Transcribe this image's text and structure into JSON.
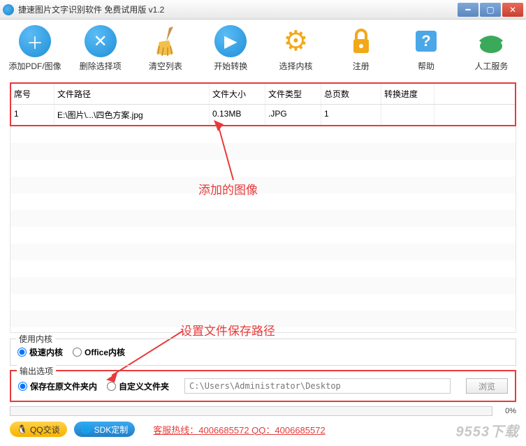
{
  "title": "捷速图片文字识别软件 免费试用版 v1.2",
  "toolbar": [
    {
      "id": "add",
      "label": "添加PDF/图像",
      "glyph": "+"
    },
    {
      "id": "del",
      "label": "删除选择项",
      "glyph": "✕"
    },
    {
      "id": "clear",
      "label": "清空列表",
      "glyph": "broom"
    },
    {
      "id": "start",
      "label": "开始转换",
      "glyph": "▶"
    },
    {
      "id": "engine",
      "label": "选择内核",
      "glyph": "⚙"
    },
    {
      "id": "reg",
      "label": "注册",
      "glyph": "lock"
    },
    {
      "id": "help",
      "label": "帮助",
      "glyph": "?"
    },
    {
      "id": "service",
      "label": "人工服务",
      "glyph": "phone"
    }
  ],
  "table": {
    "headers": {
      "no": "席号",
      "path": "文件路径",
      "size": "文件大小",
      "type": "文件类型",
      "pages": "总页数",
      "progress": "转换进度"
    },
    "rows": [
      {
        "no": "1",
        "path": "E:\\图片\\...\\四色方案.jpg",
        "size": "0.13MB",
        "type": ".JPG",
        "pages": "1",
        "progress": ""
      }
    ]
  },
  "annotations": {
    "added_image": "添加的图像",
    "save_path": "设置文件保存路径"
  },
  "engine_group": {
    "legend": "使用内核",
    "fast": "极速内核",
    "office": "Office内核"
  },
  "output_group": {
    "legend": "输出选项",
    "save_orig": "保存在原文件夹内",
    "save_custom": "自定义文件夹",
    "path_value": "C:\\Users\\Administrator\\Desktop",
    "browse": "浏览"
  },
  "progress_pct": "0%",
  "footer": {
    "qq": "QQ交谈",
    "sdk": "SDK定制",
    "hotline": "客服热线：4006685572 QQ：4006685572"
  },
  "watermark": "9553下载"
}
